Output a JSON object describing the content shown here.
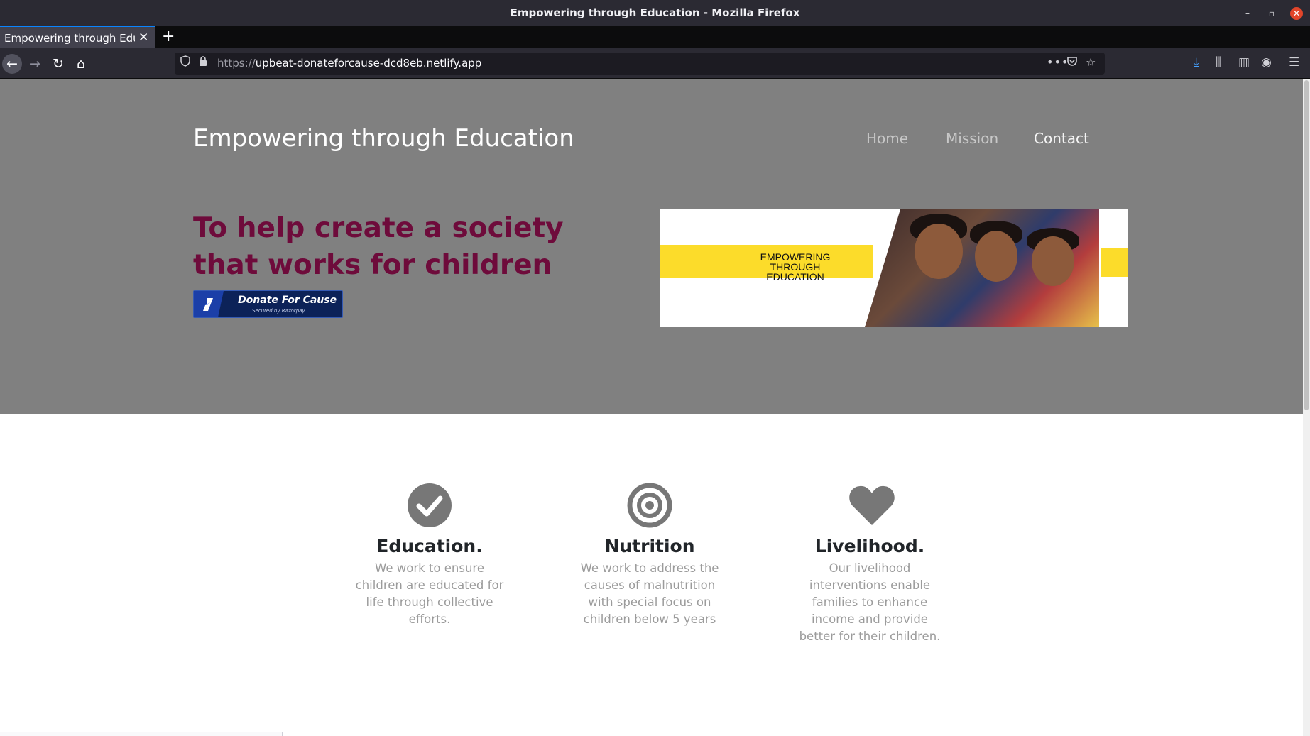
{
  "window": {
    "title": "Empowering through Education - Mozilla Firefox",
    "minimize": "–",
    "maximize": "▫",
    "close": "✕"
  },
  "tab": {
    "label": "Empowering through Education",
    "close": "✕",
    "new_tab": "+"
  },
  "nav": {
    "back": "←",
    "forward": "→",
    "reload": "↻",
    "home": "⌂",
    "url_protocol": "https://",
    "url_host": "upbeat-donateforcause-dcd8eb.netlify.app",
    "more": "•••",
    "pocket": "◙",
    "star": "☆",
    "download": "⤓",
    "library": "⫼",
    "sidebar": "▥",
    "account": "◉",
    "menu": "☰"
  },
  "site": {
    "brand": "Empowering through Education",
    "menu": {
      "home": "Home",
      "mission": "Mission",
      "contact": "Contact"
    },
    "headline": "To help create a society that works for children autism.",
    "donate_button": {
      "label": "Donate For Cause",
      "sub": "Secured by Razorpay"
    },
    "banner_text": "EMPOWERING\nTHROUGH\nEDUCATION"
  },
  "features": [
    {
      "icon": "check-circle-icon",
      "title": "Education.",
      "text": "We work to ensure children are educated for life through collective efforts."
    },
    {
      "icon": "target-icon",
      "title": "Nutrition",
      "text": "We work to address the causes of malnutrition with special focus on children below 5 years"
    },
    {
      "icon": "heart-icon",
      "title": "Livelihood.",
      "text": "Our livelihood interventions enable families to enhance income and provide better for their children."
    }
  ],
  "colors": {
    "hero_bg": "#808080",
    "headline": "#6e0b3b",
    "button_bg": "#0c2258",
    "banner_yellow": "#fcdc2a",
    "icon_gray": "#777777"
  }
}
